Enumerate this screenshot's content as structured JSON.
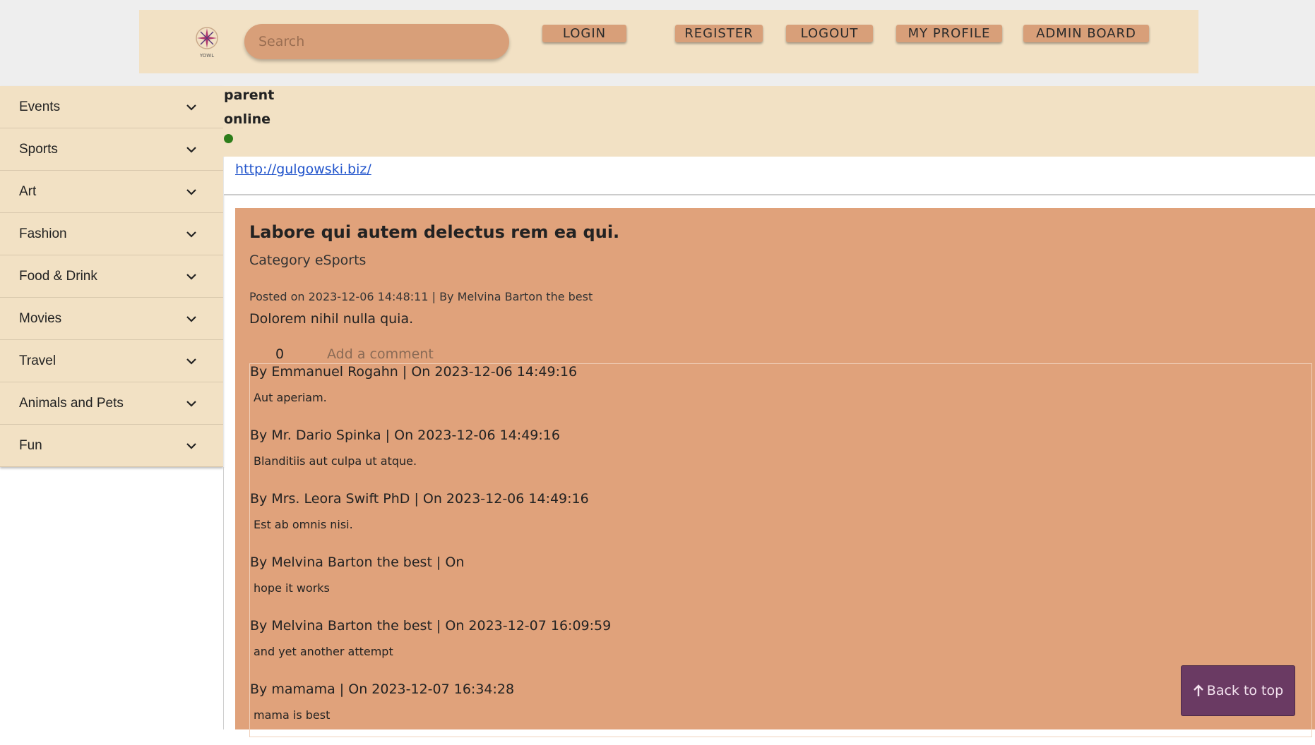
{
  "header": {
    "logo_icon": "yowl-logo",
    "logo_text": "YOWL",
    "search_placeholder": "Search",
    "nav": {
      "login": "LOGIN",
      "register": "REGISTER",
      "logout": "LOGOUT",
      "my_profile": "MY PROFILE",
      "admin_board": "ADMIN BOARD"
    }
  },
  "sidebar": {
    "items": [
      {
        "label": "Events"
      },
      {
        "label": "Sports"
      },
      {
        "label": "Art"
      },
      {
        "label": "Fashion"
      },
      {
        "label": "Food & Drink"
      },
      {
        "label": "Movies"
      },
      {
        "label": "Travel"
      },
      {
        "label": "Animals and Pets"
      },
      {
        "label": "Fun"
      }
    ],
    "chevron_icon": "chevron-down-icon"
  },
  "user": {
    "name": "parent",
    "status": "online",
    "status_color": "#2d7d1a",
    "link": "http://gulgowski.biz/"
  },
  "post": {
    "title": "Labore qui autem delectus rem ea qui.",
    "category": "Category eSports",
    "meta": "Posted on 2023-12-06 14:48:11 | By Melvina Barton the best",
    "body": "Dolorem nihil nulla quia.",
    "likes": "0",
    "add_comment": "Add a comment"
  },
  "comments": [
    {
      "head": "By Emmanuel Rogahn | On 2023-12-06 14:49:16",
      "text": "Aut aperiam."
    },
    {
      "head": "By Mr. Dario Spinka | On 2023-12-06 14:49:16",
      "text": "Blanditiis aut culpa ut atque."
    },
    {
      "head": "By Mrs. Leora Swift PhD | On 2023-12-06 14:49:16",
      "text": "Est ab omnis nisi."
    },
    {
      "head": "By Melvina Barton the best | On",
      "text": "hope it works"
    },
    {
      "head": "By Melvina Barton the best | On 2023-12-07 16:09:59",
      "text": "and yet another attempt"
    },
    {
      "head": "By mamama | On 2023-12-07 16:34:28",
      "text": "mama is best"
    }
  ],
  "back_to_top": {
    "label": "Back to top",
    "icon": "arrow-up-icon"
  },
  "colors": {
    "header_bg": "#f2e1c4",
    "accent": "#d89f79",
    "post_bg": "#e0a27b",
    "back_to_top_bg": "#6a3a63"
  }
}
